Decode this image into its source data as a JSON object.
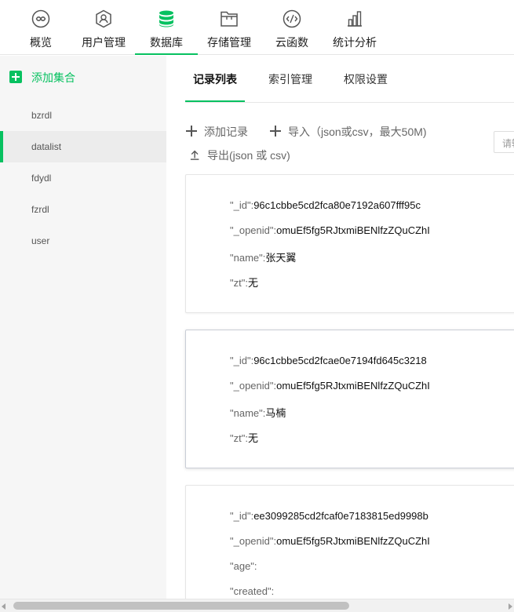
{
  "nav": {
    "items": [
      {
        "label": "概览",
        "icon": "overview-icon"
      },
      {
        "label": "用户管理",
        "icon": "user-icon"
      },
      {
        "label": "数据库",
        "icon": "database-icon",
        "active": true
      },
      {
        "label": "存储管理",
        "icon": "folder-icon"
      },
      {
        "label": "云函数",
        "icon": "function-icon"
      },
      {
        "label": "统计分析",
        "icon": "chart-icon"
      }
    ],
    "accent": "#07c160"
  },
  "sidebar": {
    "add_label": "添加集合",
    "collections": [
      "bzrdl",
      "datalist",
      "fdydl",
      "fzrdl",
      "user"
    ],
    "active": "datalist"
  },
  "tabs": [
    "记录列表",
    "索引管理",
    "权限设置"
  ],
  "toolbar": {
    "add_record": "添加记录",
    "import": "导入（json或csv，最大50M)",
    "export": "导出(json 或 csv)",
    "search_placeholder": "请输"
  },
  "records": [
    {
      "fields": [
        {
          "key": "\"_id\":",
          "value": "96c1cbbe5cd2fca80e7192a607fff95c"
        },
        {
          "key": "\"_openid\":",
          "value": "omuEf5fg5RJtxmiBENlfzZQuCZhI"
        },
        {
          "key": "\"name\":",
          "value": "张天翼"
        },
        {
          "key": "\"zt\":",
          "value": "无"
        }
      ]
    },
    {
      "fields": [
        {
          "key": "\"_id\":",
          "value": "96c1cbbe5cd2fcae0e7194fd645c3218"
        },
        {
          "key": "\"_openid\":",
          "value": "omuEf5fg5RJtxmiBENlfzZQuCZhI"
        },
        {
          "key": "\"name\":",
          "value": "马楠"
        },
        {
          "key": "\"zt\":",
          "value": "无"
        }
      ]
    },
    {
      "fields": [
        {
          "key": "\"_id\":",
          "value": "ee3099285cd2fcaf0e7183815ed9998b"
        },
        {
          "key": "\"_openid\":",
          "value": "omuEf5fg5RJtxmiBENlfzZQuCZhI"
        },
        {
          "key": "\"age\":",
          "value": ""
        },
        {
          "key": "\"created\":",
          "value": ""
        }
      ]
    }
  ]
}
